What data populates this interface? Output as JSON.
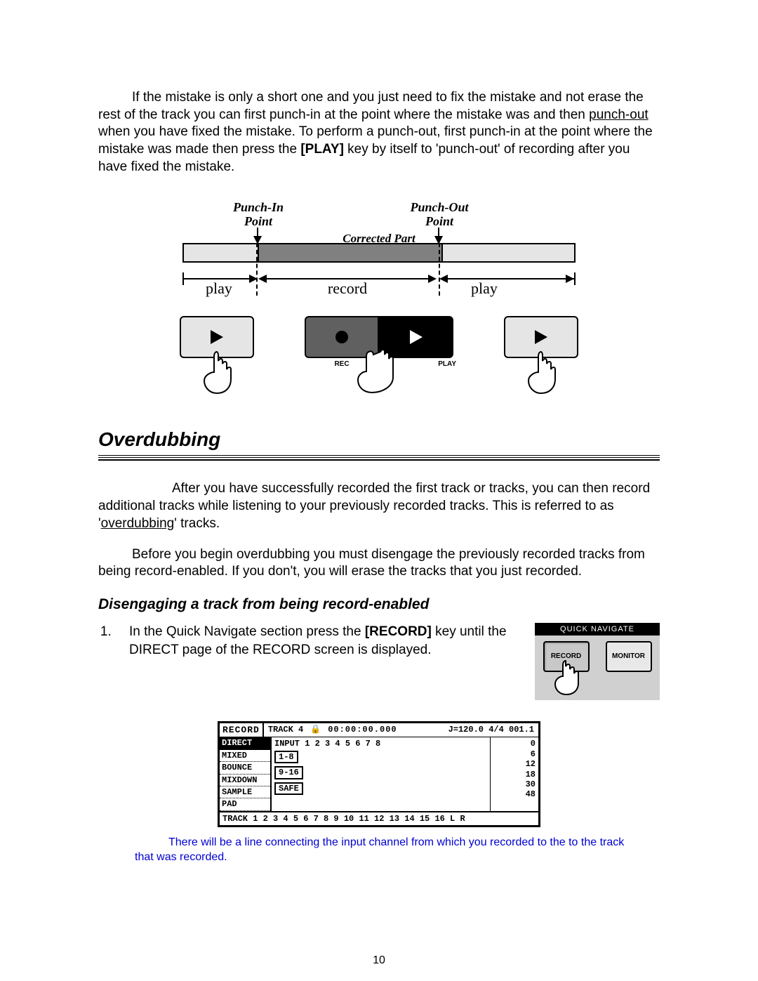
{
  "intro": {
    "t1a": "If the mistake is only a short one and you just need to fix the mistake and not erase the rest of the track you can first punch-in at the point where the mistake was and then ",
    "t1b": "punch-out",
    "t1c": " when you have fixed the mistake.  To perform a punch-out, first punch-in at the point where the mistake was made then press the ",
    "t1d": "[PLAY]",
    "t1e": " key by itself to 'punch-out' of recording after you have fixed the mistake."
  },
  "diagram": {
    "punch_in": "Punch-In\nPoint",
    "punch_out": "Punch-Out\nPoint",
    "corrected": "Corrected Part",
    "play": "play",
    "record": "record",
    "rec_tag": "REC",
    "play_tag": "PLAY"
  },
  "section_title": "Overdubbing",
  "overdub": {
    "p1a": "After you have successfully recorded the first track or tracks, you can then record additional tracks while listening to your previously recorded tracks. This is referred to as '",
    "p1b": "overdubbing",
    "p1c": "' tracks.",
    "p2": "Before you begin overdubbing you must disengage the previously recorded tracks from being record-enabled.  If you don't, you will erase the tracks that you just recorded."
  },
  "subheading": "Disengaging a track from being record-enabled",
  "step1": {
    "a": "In the Quick Navigate section press the ",
    "b": "[RECORD]",
    "c": " key until the DIRECT page of the RECORD screen is displayed."
  },
  "quicknav": {
    "header": "QUICK  NAVIGATE",
    "record": "RECORD",
    "monitor": "MONITOR"
  },
  "screen": {
    "title": "RECORD",
    "track": "TRACK  4",
    "tc": "00:00:00.000",
    "tempo": "J=120.0 4/4 001.1",
    "tabs": [
      "DIRECT",
      "MIXED",
      "BOUNCE",
      "MIXDOWN",
      "SAMPLE",
      "PAD"
    ],
    "input_row": "INPUT 1 2 3 4 5 6 7 8",
    "btn_1_8": "1-8",
    "btn_9_16": "9-16",
    "btn_safe": "SAFE",
    "bottom": "TRACK 1 2 3 4 5 6 7 8 9 10 11 12 13 14 15 16  L R",
    "meters": [
      "0",
      "6",
      "12",
      "18",
      "30",
      "48"
    ]
  },
  "note_blue": "There will be a line connecting the input channel from which you recorded to the to the track that was recorded.",
  "page_number": "10"
}
